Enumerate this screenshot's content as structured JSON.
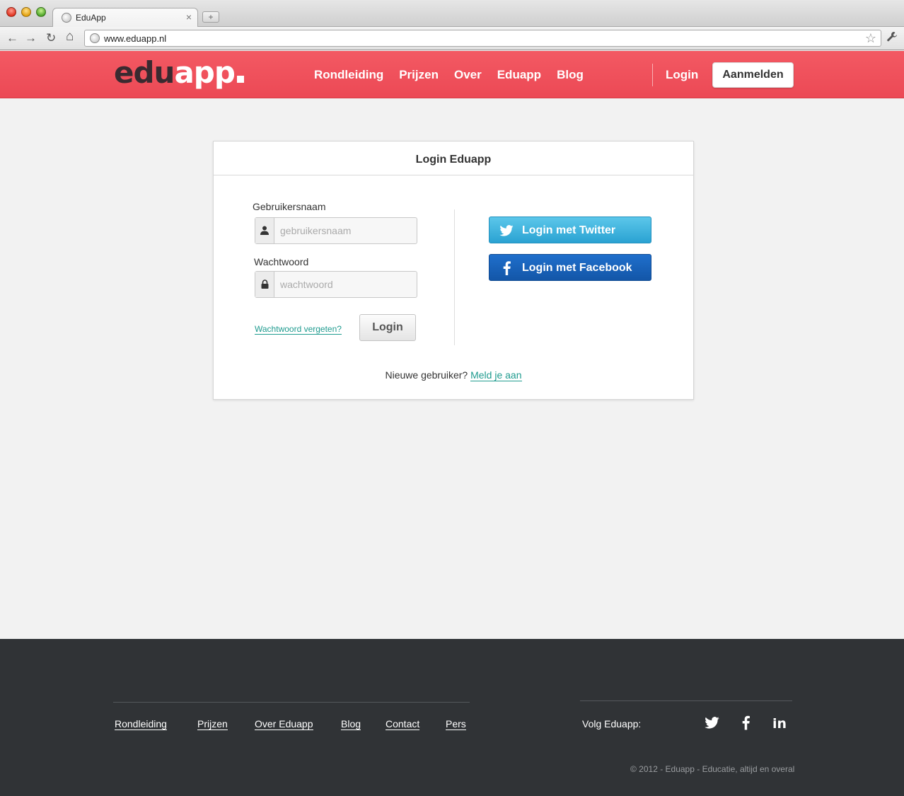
{
  "browser": {
    "tab_title": "EduApp",
    "tab_close": "×",
    "new_tab": "+",
    "url": "www.eduapp.nl",
    "back": "←",
    "forward": "→",
    "reload": "↻",
    "home": "⌂",
    "star": "☆",
    "wrench": "🔧"
  },
  "header": {
    "logo_part1": "edu",
    "logo_part2": "app",
    "nav": [
      "Rondleiding",
      "Prijzen",
      "Over",
      "Eduapp",
      "Blog"
    ],
    "login": "Login",
    "signup": "Aanmelden"
  },
  "login_card": {
    "title": "Login Eduapp",
    "username_label": "Gebruikersnaam",
    "username_placeholder": "gebruikersnaam",
    "password_label": "Wachtwoord",
    "password_placeholder": "wachtwoord",
    "forgot": "Wachtwoord vergeten?",
    "login_button": "Login",
    "twitter_button": "Login met Twitter",
    "facebook_button": "Login met Facebook",
    "new_user_text": "Nieuwe gebruiker?",
    "signup_link": "Meld je aan"
  },
  "footer": {
    "links": [
      "Rondleiding",
      "Prijzen",
      "Over Eduapp",
      "Blog",
      "Contact",
      "Pers"
    ],
    "follow": "Volg Eduapp:",
    "social_icons": [
      "twitter-icon",
      "facebook-icon",
      "linkedin-icon"
    ],
    "linkedin_text": "in",
    "copyright": "© 2012 - Eduapp - Educatie, altijd en overal"
  },
  "colors": {
    "header_red": "#ec4955",
    "link_teal": "#1f9b8f",
    "twitter_blue": "#2aa2d2",
    "facebook_blue": "#1356a8",
    "footer_dark": "#303336"
  }
}
